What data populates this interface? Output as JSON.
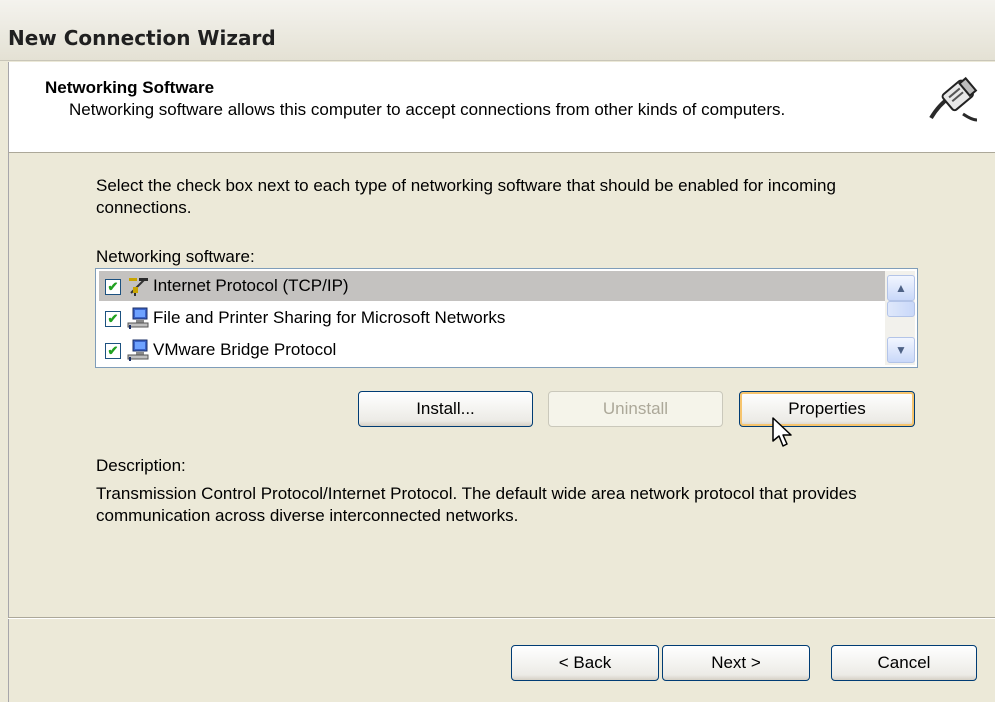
{
  "window": {
    "title": "New Connection Wizard"
  },
  "header": {
    "title": "Networking Software",
    "description": "Networking software allows this computer to accept connections from other kinds of computers.",
    "icon": "network-cable-icon"
  },
  "instructions": "Select the check box next to each type of networking software that should be enabled for incoming connections.",
  "networking_software": {
    "label": "Networking software:",
    "items": [
      {
        "label": "Internet Protocol (TCP/IP)",
        "checked": true,
        "selected": true,
        "icon": "protocol-icon"
      },
      {
        "label": "File and Printer Sharing for Microsoft Networks",
        "checked": true,
        "selected": false,
        "icon": "computer-network-icon"
      },
      {
        "label": "VMware Bridge Protocol",
        "checked": true,
        "selected": false,
        "icon": "computer-network-icon"
      }
    ]
  },
  "buttons": {
    "install": "Install...",
    "uninstall": "Uninstall",
    "properties": "Properties",
    "back": "< Back",
    "next": "Next >",
    "cancel": "Cancel"
  },
  "description": {
    "label": "Description:",
    "text": "Transmission Control Protocol/Internet Protocol. The default wide area network protocol that provides communication across diverse interconnected networks."
  },
  "colors": {
    "dialog_background": "#ece9d8",
    "selected_row": "#c4c2c0",
    "button_border": "#003c74",
    "focus_highlight": "#f6c46d"
  }
}
